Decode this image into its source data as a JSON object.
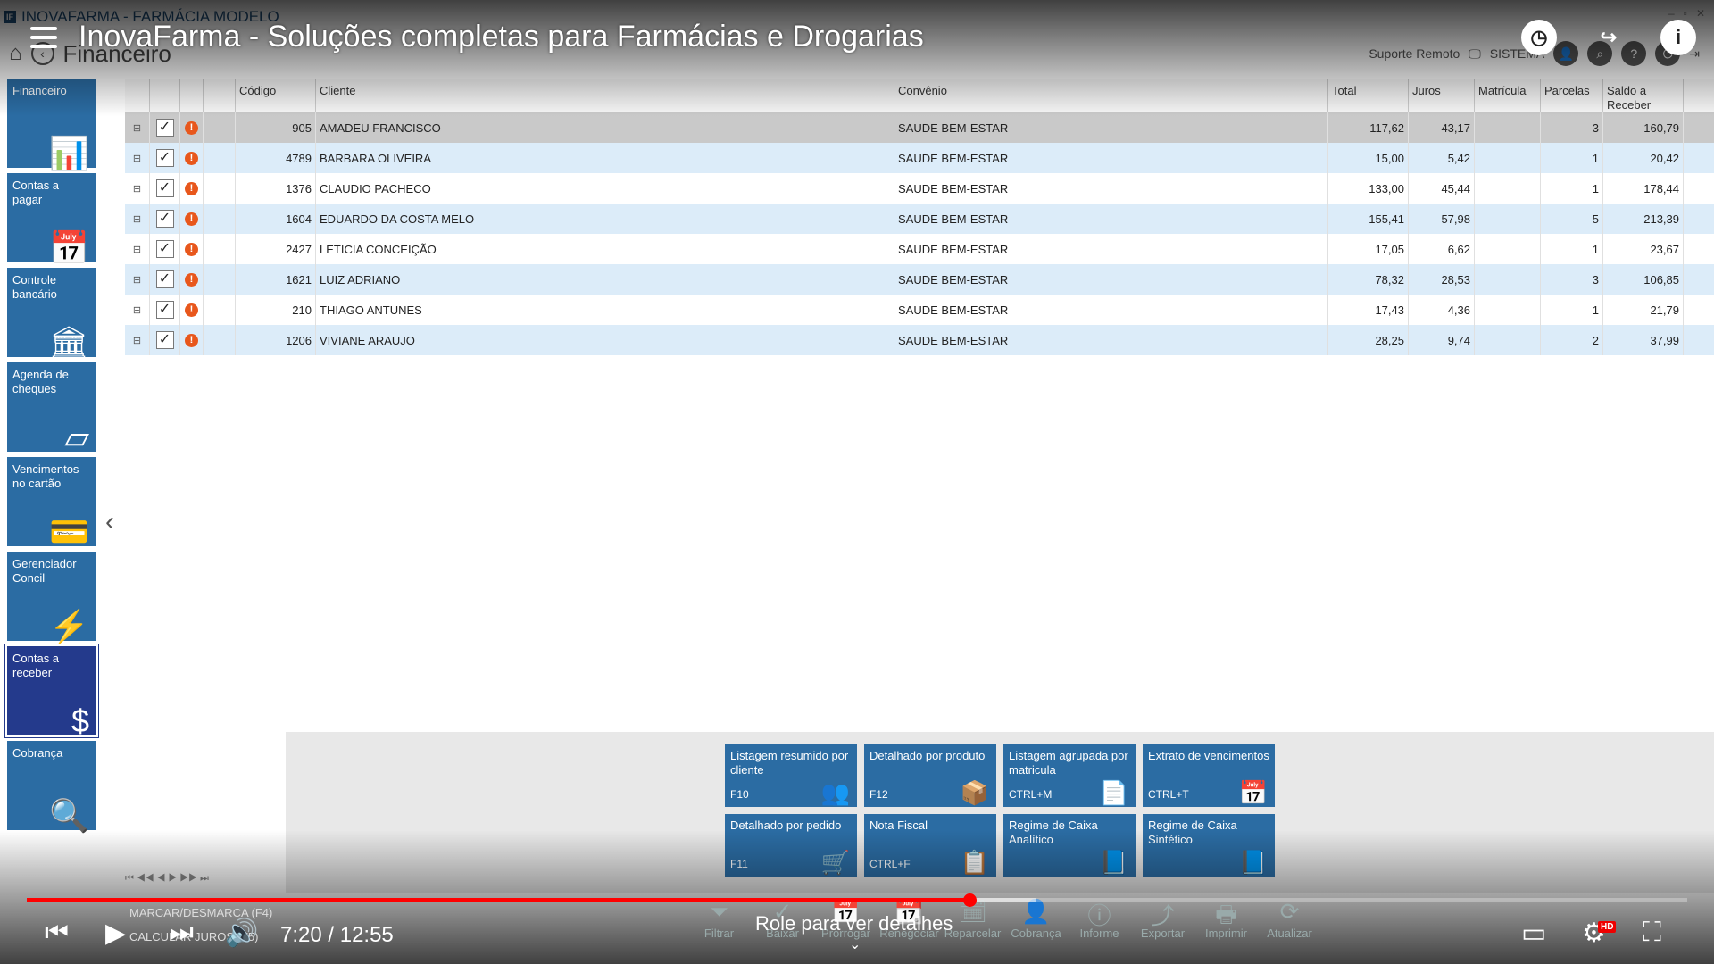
{
  "app": {
    "window_title": "INOVAFARMA - FARMÁCIA MODELO",
    "page_title": "Financeiro",
    "header_right": {
      "remote_support": "Suporte Remoto",
      "system": "SISTEMA"
    }
  },
  "video": {
    "title": "InovaFarma - Soluções completas para Farmácias e Drogarias",
    "time": "7:20 / 12:55",
    "progress": 0.5677,
    "buffered": 0.5677,
    "scroll_hint": "Role para ver detalhes",
    "hd_badge": "HD"
  },
  "sidebar": {
    "items": [
      {
        "label": "Financeiro",
        "icon": "chart-dollar-icon"
      },
      {
        "label": "Contas a pagar",
        "icon": "calendar-icon"
      },
      {
        "label": "Controle bancário",
        "icon": "bank-icon"
      },
      {
        "label": "Agenda de cheques",
        "icon": "cheque-icon"
      },
      {
        "label": "Vencimentos no cartão",
        "icon": "card-icon"
      },
      {
        "label": "Gerenciador Concil",
        "icon": "lightning-icon"
      },
      {
        "label": "Contas a receber",
        "icon": "coins-icon",
        "active": true
      },
      {
        "label": "Cobrança",
        "icon": "magnifier-dollar-icon"
      }
    ]
  },
  "grid": {
    "columns": [
      "Código",
      "Cliente",
      "Convênio",
      "Total",
      "Juros",
      "Matrícula",
      "Parcelas",
      "Saldo a Receber"
    ],
    "rows": [
      {
        "codigo": "905",
        "cliente": "AMADEU FRANCISCO",
        "convenio": "SAUDE BEM-ESTAR",
        "total": "117,62",
        "juros": "43,17",
        "matricula": "",
        "parcelas": "3",
        "saldo": "160,79"
      },
      {
        "codigo": "4789",
        "cliente": "BARBARA OLIVEIRA",
        "convenio": "SAUDE BEM-ESTAR",
        "total": "15,00",
        "juros": "5,42",
        "matricula": "",
        "parcelas": "1",
        "saldo": "20,42"
      },
      {
        "codigo": "1376",
        "cliente": "CLAUDIO PACHECO",
        "convenio": "SAUDE BEM-ESTAR",
        "total": "133,00",
        "juros": "45,44",
        "matricula": "",
        "parcelas": "1",
        "saldo": "178,44"
      },
      {
        "codigo": "1604",
        "cliente": "EDUARDO DA COSTA MELO",
        "convenio": "SAUDE BEM-ESTAR",
        "total": "155,41",
        "juros": "57,98",
        "matricula": "",
        "parcelas": "5",
        "saldo": "213,39"
      },
      {
        "codigo": "2427",
        "cliente": "LETICIA CONCEIÇÃO",
        "convenio": "SAUDE BEM-ESTAR",
        "total": "17,05",
        "juros": "6,62",
        "matricula": "",
        "parcelas": "1",
        "saldo": "23,67"
      },
      {
        "codigo": "1621",
        "cliente": "LUIZ ADRIANO",
        "convenio": "SAUDE BEM-ESTAR",
        "total": "78,32",
        "juros": "28,53",
        "matricula": "",
        "parcelas": "3",
        "saldo": "106,85"
      },
      {
        "codigo": "210",
        "cliente": "THIAGO ANTUNES",
        "convenio": "SAUDE BEM-ESTAR",
        "total": "17,43",
        "juros": "4,36",
        "matricula": "",
        "parcelas": "1",
        "saldo": "21,79"
      },
      {
        "codigo": "1206",
        "cliente": "VIVIANE ARAUJO",
        "convenio": "SAUDE BEM-ESTAR",
        "total": "28,25",
        "juros": "9,74",
        "matricula": "",
        "parcelas": "2",
        "saldo": "37,99"
      }
    ]
  },
  "reports": [
    {
      "label": "Listagem resumido por cliente",
      "key": "F10",
      "icon": "users-icon"
    },
    {
      "label": "Detalhado por produto",
      "key": "F12",
      "icon": "box-icon"
    },
    {
      "label": "Listagem agrupada por matricula",
      "key": "CTRL+M",
      "icon": "document-icon"
    },
    {
      "label": "Extrato de vencimentos",
      "key": "CTRL+T",
      "icon": "calendar-icon"
    },
    {
      "label": "Detalhado por pedido",
      "key": "F11",
      "icon": "cart-icon"
    },
    {
      "label": "Nota Fiscal",
      "key": "CTRL+F",
      "icon": "clipboard-icon"
    },
    {
      "label": "Regime de Caixa Analítico",
      "key": "",
      "icon": "book-icon"
    },
    {
      "label": "Regime de Caixa Sintético",
      "key": "",
      "icon": "book-icon"
    }
  ],
  "footer": {
    "marcar": "MARCAR/DESMARCA (F4)",
    "calcular": "CALCULAR JUROS (F5)",
    "toolbar": [
      "Filtrar",
      "Baixar",
      "Prorrogar",
      "Renegociar",
      "Reparcelar",
      "Cobrança",
      "Informe",
      "Exportar",
      "Imprimir",
      "Atualizar"
    ]
  }
}
